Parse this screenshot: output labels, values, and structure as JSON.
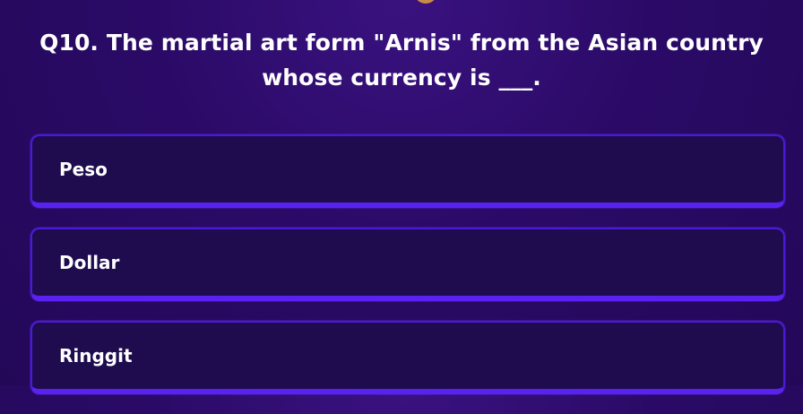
{
  "question": {
    "text": "Q10. The martial art form \"Arnis\" from the Asian country whose currency is ___."
  },
  "options": [
    {
      "label": "Peso"
    },
    {
      "label": "Dollar"
    },
    {
      "label": "Ringgit"
    }
  ],
  "colors": {
    "background": "#2a0a66",
    "option_fill": "#1e0c4e",
    "option_border": "#4a1ad8",
    "accent": "#e2a040"
  }
}
